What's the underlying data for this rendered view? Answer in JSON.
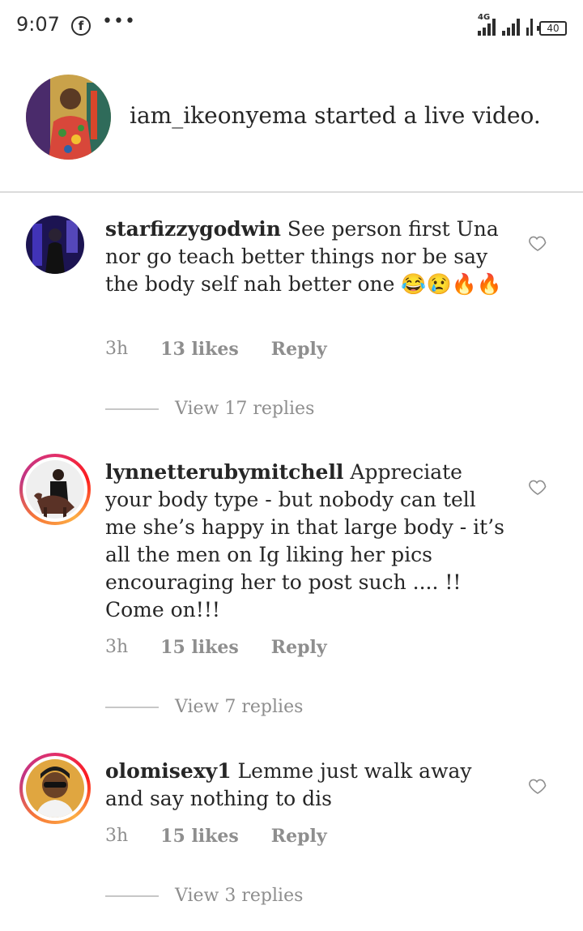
{
  "status_bar": {
    "time": "9:07",
    "fb_icon_letter": "f",
    "dots": "•••",
    "network_tag": "4G",
    "battery": "40"
  },
  "notification": {
    "text": "iam_ikeonyema started a live video."
  },
  "comments": [
    {
      "username": "starfizzygodwin",
      "text": " See person first Una nor go teach better things nor be say the body self nah better one 😂😢🔥🔥",
      "time": "3h",
      "likes": "13 likes",
      "reply_label": "Reply",
      "view_replies": "View 17 replies",
      "story_ring": false
    },
    {
      "username": "lynnetterubymitchell",
      "text": " Appreciate your body type - but nobody can tell me she’s happy in that large body - it’s all the men on Ig liking her pics encouraging her to post such .... !! Come on!!!",
      "time": "3h",
      "likes": "15 likes",
      "reply_label": "Reply",
      "view_replies": "View 7 replies",
      "story_ring": true
    },
    {
      "username": "olomisexy1",
      "text": " Lemme just walk away and say nothing to dis",
      "time": "3h",
      "likes": "15 likes",
      "reply_label": "Reply",
      "view_replies": "View 3 replies",
      "story_ring": true
    }
  ],
  "colors": {
    "text_primary": "#262626",
    "text_secondary": "#8e8e8e",
    "divider": "#dbdbdb"
  },
  "icons": {
    "like": "heart-outline-icon",
    "facebook": "facebook-icon"
  }
}
